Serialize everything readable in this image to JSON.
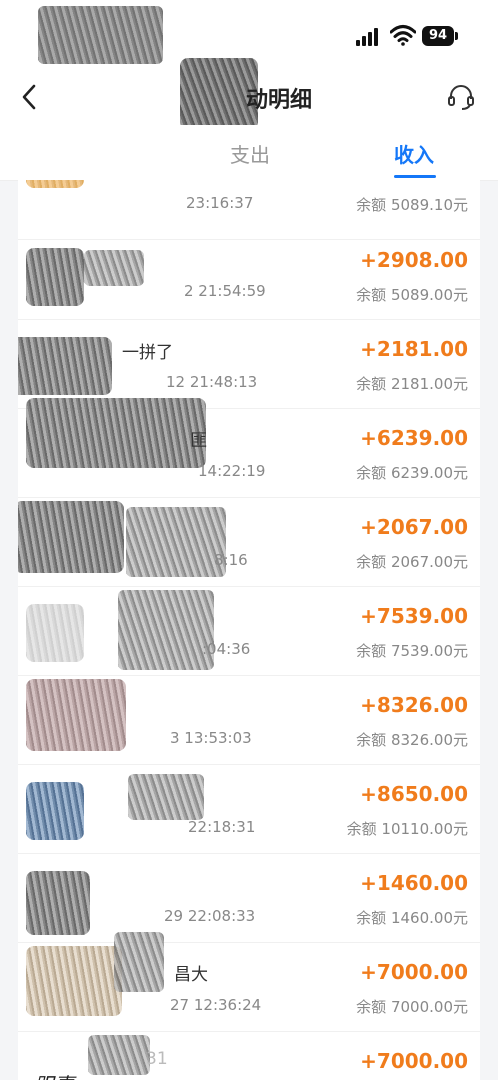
{
  "status_bar": {
    "battery": "94"
  },
  "header": {
    "title": "动明细"
  },
  "tabs": [
    {
      "label": "支出"
    },
    {
      "label": "收入"
    }
  ],
  "transactions": [
    {
      "name": "",
      "datetime": "23:16:37",
      "amount": "",
      "balance_label": "余额",
      "balance": "5089.10元"
    },
    {
      "name": "",
      "datetime": "2 21:54:59",
      "amount": "+2908.00",
      "balance_label": "余额",
      "balance": "5089.00元"
    },
    {
      "name": "一拼了",
      "datetime": "12 21:48:13",
      "amount": "+2181.00",
      "balance_label": "余额",
      "balance": "2181.00元"
    },
    {
      "name": "匪",
      "datetime": "14:22:19",
      "amount": "+6239.00",
      "balance_label": "余额",
      "balance": "6239.00元"
    },
    {
      "name": "",
      "datetime": "8:16",
      "amount": "+2067.00",
      "balance_label": "余额",
      "balance": "2067.00元"
    },
    {
      "name": "",
      "datetime": ":04:36",
      "amount": "+7539.00",
      "balance_label": "余额",
      "balance": "7539.00元"
    },
    {
      "name": "",
      "datetime": "3 13:53:03",
      "amount": "+8326.00",
      "balance_label": "余额",
      "balance": "8326.00元"
    },
    {
      "name": "",
      "datetime": "22:18:31",
      "amount": "+8650.00",
      "balance_label": "余额",
      "balance": "10110.00元"
    },
    {
      "name": "",
      "datetime": "29 22:08:33",
      "amount": "+1460.00",
      "balance_label": "余额",
      "balance": "1460.00元"
    },
    {
      "name": "昌大",
      "datetime": "27 12:36:24",
      "amount": "+7000.00",
      "balance_label": "余额",
      "balance": "7000.00元"
    },
    {
      "name": "31",
      "datetime": "",
      "amount": "+7000.00",
      "balance_label": "",
      "balance": ""
    }
  ]
}
